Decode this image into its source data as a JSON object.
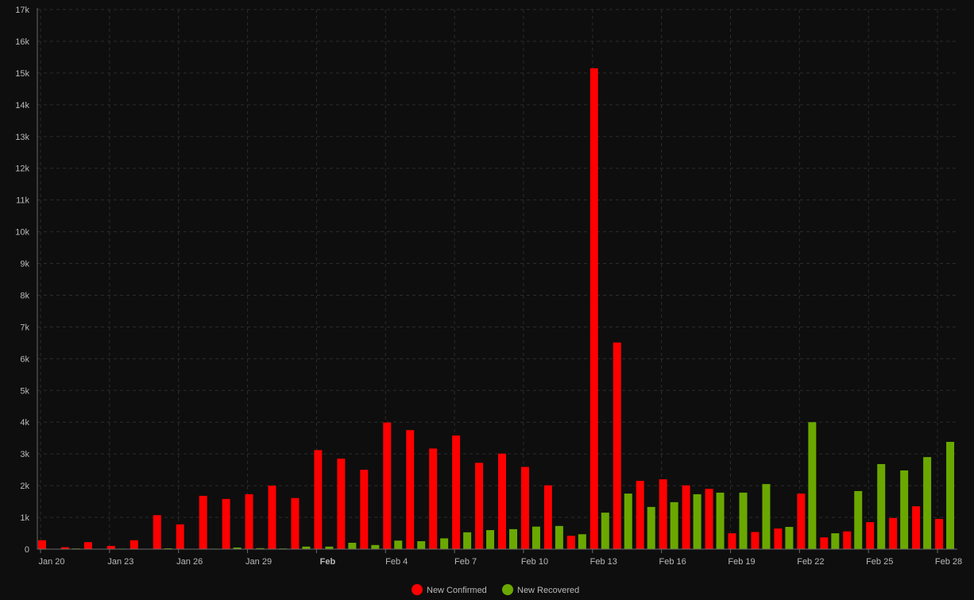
{
  "chart_data": {
    "type": "bar",
    "x": [
      "Jan 20",
      "Jan 21",
      "Jan 22",
      "Jan 23",
      "Jan 24",
      "Jan 25",
      "Jan 26",
      "Jan 27",
      "Jan 28",
      "Jan 29",
      "Jan 30",
      "Jan 31",
      "Feb 1",
      "Feb 2",
      "Feb 3",
      "Feb 4",
      "Feb 5",
      "Feb 6",
      "Feb 7",
      "Feb 8",
      "Feb 9",
      "Feb 10",
      "Feb 11",
      "Feb 12",
      "Feb 13",
      "Feb 14",
      "Feb 15",
      "Feb 16",
      "Feb 17",
      "Feb 18",
      "Feb 19",
      "Feb 20",
      "Feb 21",
      "Feb 22",
      "Feb 23",
      "Feb 24",
      "Feb 25",
      "Feb 26",
      "Feb 27",
      "Feb 28"
    ],
    "x_tick_labels": [
      {
        "index": 0,
        "label": "Jan 20",
        "bold": false
      },
      {
        "index": 3,
        "label": "Jan 23",
        "bold": false
      },
      {
        "index": 6,
        "label": "Jan 26",
        "bold": false
      },
      {
        "index": 9,
        "label": "Jan 29",
        "bold": false
      },
      {
        "index": 12,
        "label": "Feb",
        "bold": true
      },
      {
        "index": 15,
        "label": "Feb 4",
        "bold": false
      },
      {
        "index": 18,
        "label": "Feb 7",
        "bold": false
      },
      {
        "index": 21,
        "label": "Feb 10",
        "bold": false
      },
      {
        "index": 24,
        "label": "Feb 13",
        "bold": false
      },
      {
        "index": 27,
        "label": "Feb 16",
        "bold": false
      },
      {
        "index": 30,
        "label": "Feb 19",
        "bold": false
      },
      {
        "index": 33,
        "label": "Feb 22",
        "bold": false
      },
      {
        "index": 36,
        "label": "Feb 25",
        "bold": false
      },
      {
        "index": 39,
        "label": "Feb 28",
        "bold": false
      }
    ],
    "series": [
      {
        "name": "New Confirmed",
        "color": "#ff0000",
        "values": [
          280,
          60,
          220,
          100,
          280,
          1070,
          780,
          1680,
          1580,
          1730,
          2000,
          1610,
          3120,
          2850,
          2500,
          3990,
          3750,
          3170,
          3580,
          2720,
          3010,
          2590,
          2010,
          420,
          15150,
          6510,
          2150,
          2200,
          2010,
          1900,
          500,
          540,
          650,
          1750,
          370,
          560,
          850,
          980,
          1350,
          950
        ]
      },
      {
        "name": "New Recovered",
        "color": "#6aa800",
        "values": [
          0,
          20,
          5,
          15,
          10,
          25,
          10,
          15,
          50,
          30,
          20,
          80,
          80,
          200,
          130,
          270,
          250,
          340,
          530,
          600,
          630,
          710,
          730,
          470,
          1150,
          1750,
          1330,
          1480,
          1730,
          1780,
          1780,
          2050,
          700,
          4000,
          500,
          1830,
          2680,
          2480,
          2900,
          3380
        ]
      }
    ],
    "y_ticks": [
      "0",
      "1k",
      "2k",
      "3k",
      "4k",
      "5k",
      "6k",
      "7k",
      "8k",
      "9k",
      "10k",
      "11k",
      "12k",
      "13k",
      "14k",
      "15k",
      "16k",
      "17k"
    ],
    "ylim": [
      0,
      17000
    ],
    "grid": true,
    "legend_position": "bottom-center",
    "title": "",
    "xlabel": "",
    "ylabel": ""
  },
  "colors": {
    "background": "#0e0e0e",
    "grid": "#2c2c2c",
    "axis": "#6a6a6a",
    "text": "#b9b9b9"
  }
}
